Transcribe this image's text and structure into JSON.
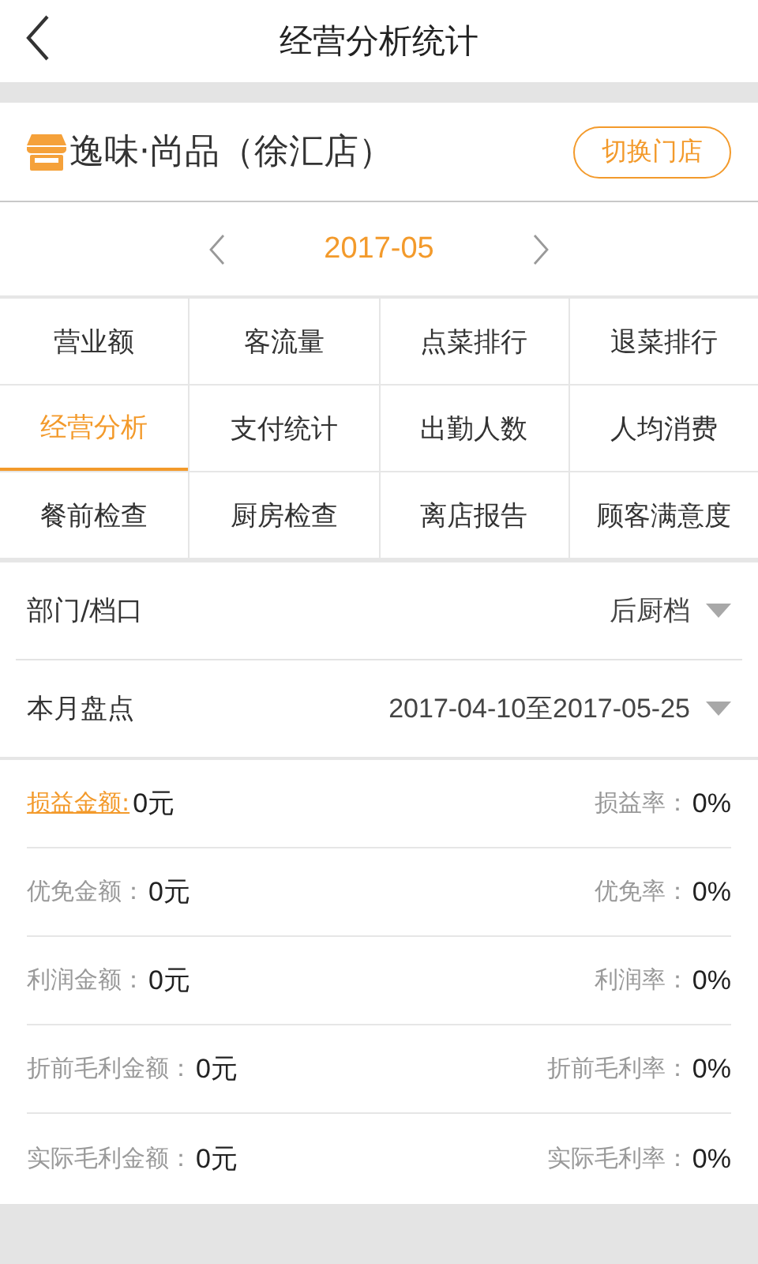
{
  "header": {
    "title": "经营分析统计"
  },
  "store": {
    "name": "逸味·尚品（徐汇店）",
    "switch_button": "切换门店"
  },
  "month": {
    "value": "2017-05"
  },
  "tabs": [
    {
      "label": "营业额",
      "selected": false
    },
    {
      "label": "客流量",
      "selected": false
    },
    {
      "label": "点菜排行",
      "selected": false
    },
    {
      "label": "退菜排行",
      "selected": false
    },
    {
      "label": "经营分析",
      "selected": true
    },
    {
      "label": "支付统计",
      "selected": false
    },
    {
      "label": "出勤人数",
      "selected": false
    },
    {
      "label": "人均消费",
      "selected": false
    },
    {
      "label": "餐前检查",
      "selected": false
    },
    {
      "label": "厨房检查",
      "selected": false
    },
    {
      "label": "离店报告",
      "selected": false
    },
    {
      "label": "顾客满意度",
      "selected": false
    }
  ],
  "filters": [
    {
      "label": "部门/档口",
      "value": "后厨档"
    },
    {
      "label": "本月盘点",
      "value": "2017-04-10至2017-05-25"
    }
  ],
  "stats": [
    {
      "kind": "link",
      "label": "损益金额:",
      "value": "0元",
      "rate_label": "损益率：",
      "rate_value": "0%"
    },
    {
      "kind": "plain",
      "label": "优免金额：",
      "value": "0元",
      "rate_label": "优免率：",
      "rate_value": "0%"
    },
    {
      "kind": "plain",
      "label": "利润金额：",
      "value": "0元",
      "rate_label": "利润率：",
      "rate_value": "0%"
    },
    {
      "kind": "plain",
      "label": "折前毛利金额：",
      "value": "0元",
      "rate_label": "折前毛利率：",
      "rate_value": "0%"
    },
    {
      "kind": "plain",
      "label": "实际毛利金额：",
      "value": "0元",
      "rate_label": "实际毛利率：",
      "rate_value": "0%"
    }
  ]
}
